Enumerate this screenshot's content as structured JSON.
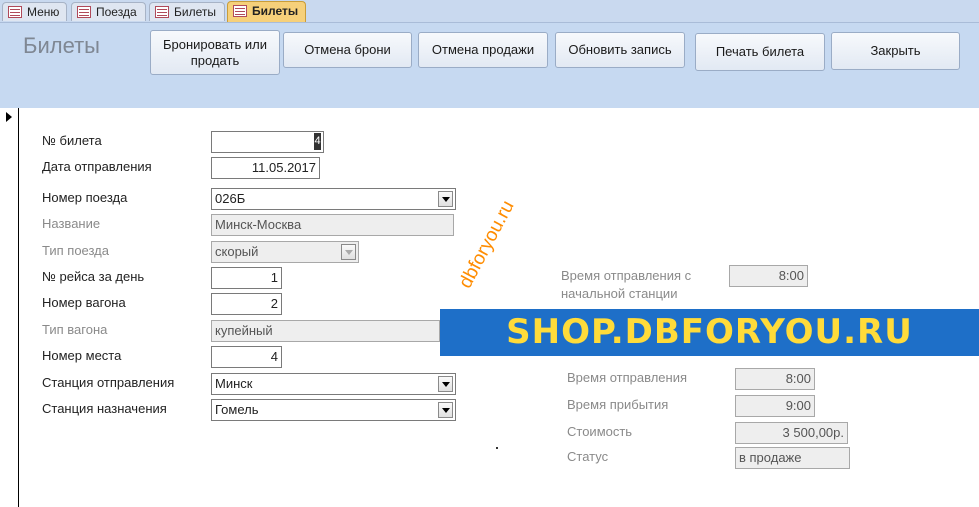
{
  "tabs": [
    {
      "label": "Меню"
    },
    {
      "label": "Поезда"
    },
    {
      "label": "Билеты"
    },
    {
      "label": "Билеты"
    }
  ],
  "header": {
    "title": "Билеты",
    "buttons": {
      "book": "Бронировать или продать",
      "cancel_booking": "Отмена брони",
      "cancel_sale": "Отмена продажи",
      "refresh": "Обновить запись",
      "print": "Печать билета",
      "close": "Закрыть"
    }
  },
  "form": {
    "ticket_no": {
      "label": "№ билета",
      "value": "4"
    },
    "departure_date": {
      "label": "Дата отправления",
      "value": "11.05.2017"
    },
    "train_no": {
      "label": "Номер поезда",
      "value": "026Б"
    },
    "name": {
      "label": "Название",
      "value": "Минск-Москва"
    },
    "train_type": {
      "label": "Тип поезда",
      "value": "скорый"
    },
    "trip_of_day": {
      "label": "№ рейса за день",
      "value": "1"
    },
    "car_no": {
      "label": "Номер вагона",
      "value": "2"
    },
    "car_type": {
      "label": "Тип вагона",
      "value": "купейный"
    },
    "seat_no": {
      "label": "Номер места",
      "value": "4"
    },
    "from_station": {
      "label": "Станция отправления",
      "value": "Минск"
    },
    "to_station": {
      "label": "Станция назначения",
      "value": "Гомель"
    },
    "start_departure": {
      "label_line1": "Время отправления с",
      "label_line2": "начальной станции",
      "value": "8:00"
    },
    "departure_time": {
      "label": "Время отправления",
      "value": "8:00"
    },
    "arrival_time": {
      "label": "Время прибытия",
      "value": "9:00"
    },
    "price": {
      "label": "Стоимость",
      "value": "3 500,00р."
    },
    "status": {
      "label": "Статус",
      "value": "в продаже"
    }
  },
  "watermarks": {
    "diagonal": "dbforyou.ru",
    "banner": "SHOP.DBFORYOU.RU"
  },
  "colors": {
    "header_bg": "#c6d9f1",
    "active_tab": "#f6d07a",
    "banner_bg": "#1e6fc8",
    "banner_text": "#ffdb3a",
    "watermark": "#ff8c00"
  }
}
